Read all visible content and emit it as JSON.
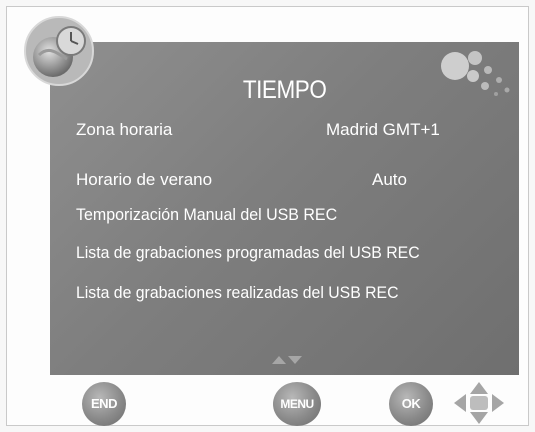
{
  "menu": {
    "title": "TIEMPO",
    "rows": [
      {
        "label": "Zona horaria",
        "value": "Madrid GMT+1"
      },
      {
        "label": "Horario de verano",
        "value": "Auto"
      },
      {
        "label": "Temporización Manual del USB REC",
        "value": ""
      },
      {
        "label": "Lista de grabaciones programadas del USB REC",
        "value": ""
      },
      {
        "label": "Lista de grabaciones realizadas del USB REC",
        "value": ""
      }
    ]
  },
  "buttons": {
    "end": "END",
    "menu": "MENU",
    "ok": "OK"
  },
  "icons": {
    "logo": "clock-globe-icon",
    "decoration": "bubbles-icon",
    "scroll": "up-down-arrows-icon",
    "navigation": "directional-pad-icon"
  },
  "colors": {
    "panel": "#808080",
    "text": "#ffffff",
    "button": "#8a8a8a"
  }
}
